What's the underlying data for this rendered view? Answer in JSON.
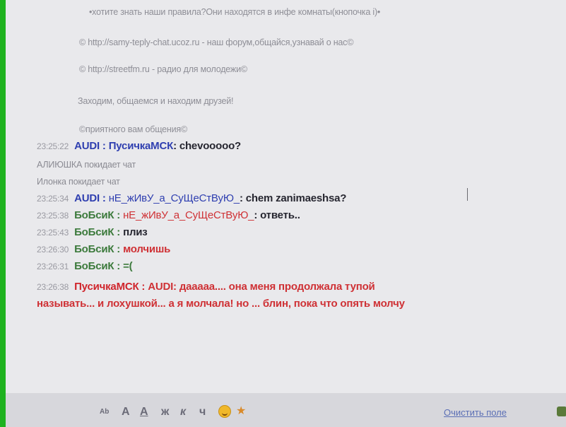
{
  "info": {
    "rules_line": "•хотите знать наши правила?Они находятся в инфе комнаты(кнопочка i)•",
    "forum_line": "© http://samy-teply-chat.ucoz.ru - наш форум,общайся,узнавай о нас©",
    "radio_line": "© http://streetfm.ru - радио для молодежи©",
    "welcome_line": "Заходим, общаемся и находим друзей!",
    "pleasant_line": "©приятного вам общения©"
  },
  "chat": {
    "m1": {
      "time": "23:25:22",
      "nick": "AUDI",
      "sep": " : ",
      "to": "ПусичкаМСК",
      "text": ": chevooooo?"
    },
    "s1": {
      "text": "АЛИЮШКА покидает чат"
    },
    "s2": {
      "text": "Илонка покидает чат"
    },
    "m2": {
      "time": "23:25:34",
      "nick": "AUDI",
      "sep": " : ",
      "to": "нЕ_жИвУ_а_СуЩеСтВуЮ_",
      "text": ": chem zanimaeshsa?"
    },
    "m3": {
      "time": "23:25:38",
      "nick": "БоБсиК",
      "sep": " : ",
      "to": "нЕ_жИвУ_а_СуЩеСтВуЮ_",
      "text": ": ответь.."
    },
    "m4": {
      "time": "23:25:43",
      "nick": "БоБсиК",
      "sep": " : ",
      "text": "плиз"
    },
    "m5": {
      "time": "23:26:30",
      "nick": "БоБсиК",
      "sep": " : ",
      "text": "молчишь"
    },
    "m6": {
      "time": "23:26:31",
      "nick": "БоБсиК",
      "sep": " : ",
      "text": "=("
    },
    "m7": {
      "time": "23:26:38",
      "nick": "ПусичкаМСК",
      "sep": " : ",
      "text": "AUDI: дааааа.... она меня продолжала тупой"
    },
    "m7b": {
      "text": "называть... и лохушкой... а я молчала! но ... блин, пока что опять молчу"
    }
  },
  "toolbar": {
    "tool_a_small": "Ab",
    "tool_a": "A",
    "tool_a_underlined": "A",
    "tool_close": "ж",
    "tool_k": "к",
    "tool_ch": "ч",
    "clear_label": "Очистить поле"
  },
  "colors": {
    "frame": "#1fb21f",
    "nick_blue": "#2f3fb0",
    "nick_green": "#3c7a3c",
    "nick_red": "#d0252c"
  }
}
